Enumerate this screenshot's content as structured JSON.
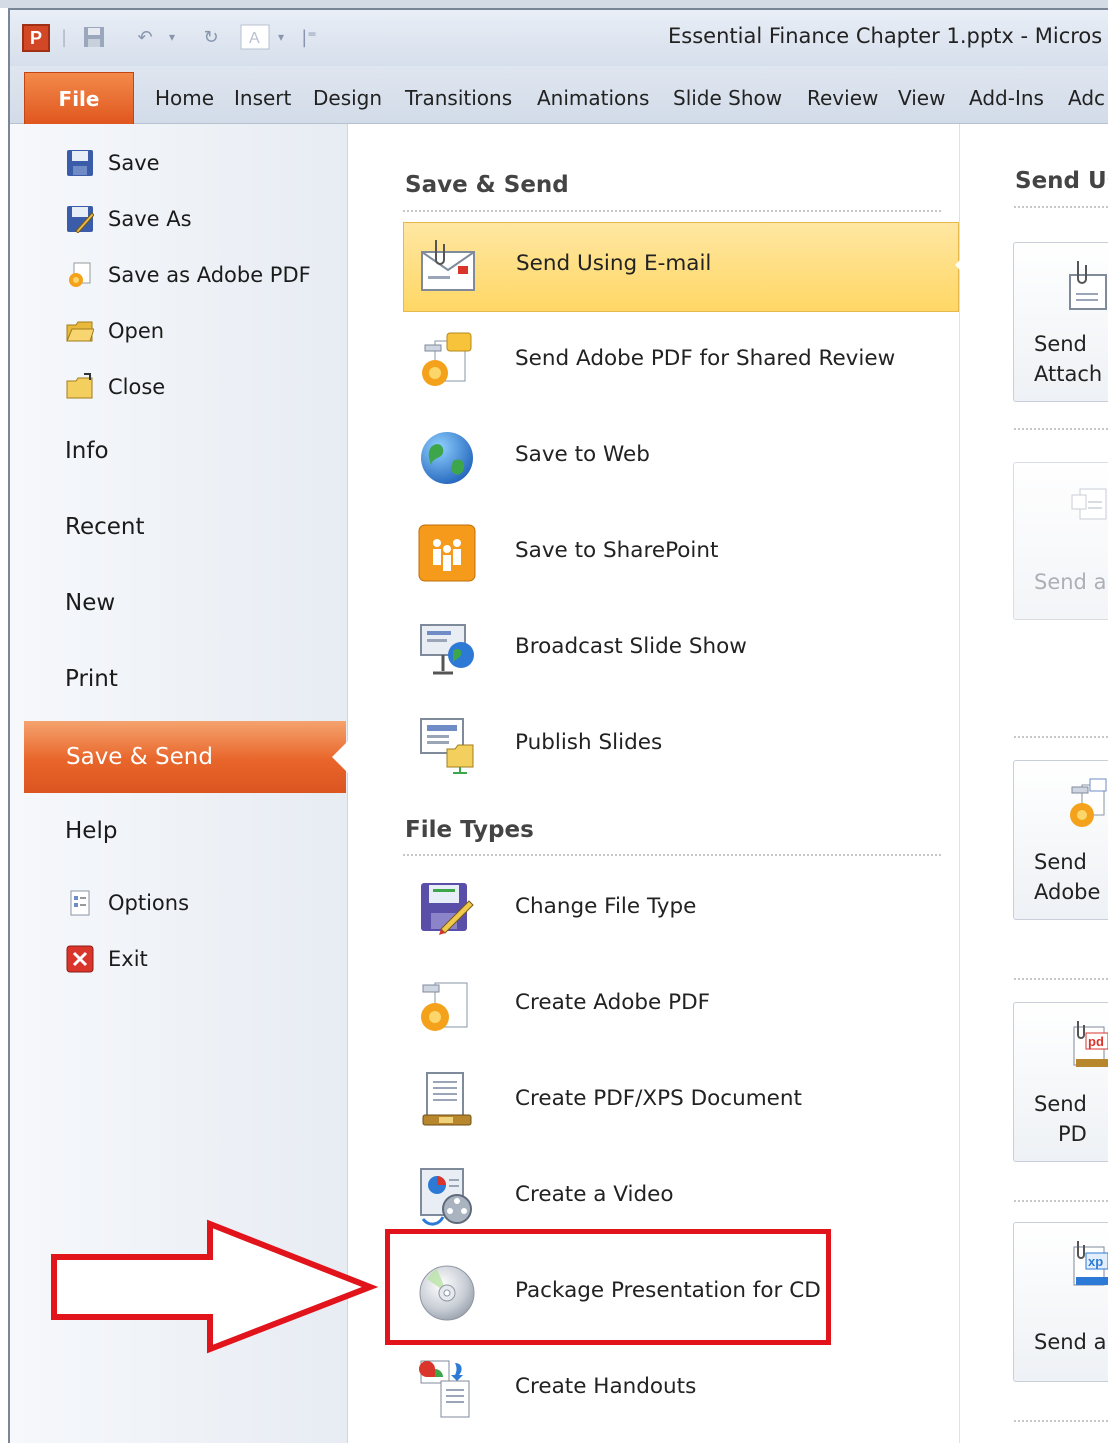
{
  "window": {
    "title": "Essential Finance Chapter 1.pptx  -  Micros",
    "app_letter": "P"
  },
  "ribbon": {
    "file_tab": "File",
    "tabs": [
      "Home",
      "Insert",
      "Design",
      "Transitions",
      "Animations",
      "Slide Show",
      "Review",
      "View",
      "Add-Ins",
      "Adc"
    ]
  },
  "nav": {
    "save": "Save",
    "save_as": "Save As",
    "save_adobe": "Save as Adobe PDF",
    "open": "Open",
    "close": "Close",
    "info": "Info",
    "recent": "Recent",
    "new": "New",
    "print": "Print",
    "save_send": "Save & Send",
    "help": "Help",
    "options": "Options",
    "exit": "Exit"
  },
  "middle": {
    "save_send_head": "Save & Send",
    "file_types_head": "File Types",
    "save_send_items": [
      {
        "label": "Send Using E-mail",
        "icon": "email-icon",
        "selected": true
      },
      {
        "label": "Send Adobe PDF for Shared Review",
        "icon": "adobe-review-icon"
      },
      {
        "label": "Save to Web",
        "icon": "globe-icon"
      },
      {
        "label": "Save to SharePoint",
        "icon": "sharepoint-icon"
      },
      {
        "label": "Broadcast Slide Show",
        "icon": "broadcast-icon"
      },
      {
        "label": "Publish Slides",
        "icon": "publish-slides-icon"
      }
    ],
    "file_type_items": [
      {
        "label": "Change File Type",
        "icon": "change-file-type-icon"
      },
      {
        "label": "Create Adobe PDF",
        "icon": "adobe-pdf-icon"
      },
      {
        "label": "Create PDF/XPS Document",
        "icon": "pdf-xps-icon"
      },
      {
        "label": "Create a Video",
        "icon": "video-icon"
      },
      {
        "label": "Package Presentation for CD",
        "icon": "cd-icon"
      },
      {
        "label": "Create Handouts",
        "icon": "handouts-icon"
      }
    ]
  },
  "right": {
    "head": "Send Us",
    "buttons": [
      {
        "line1": "Send",
        "line2": "Attach"
      },
      {
        "line1": "Send a",
        "line2": ""
      },
      {
        "line1": "Send",
        "line2": "Adobe"
      },
      {
        "line1": "Send",
        "line2": "PD"
      },
      {
        "line1": "Send a",
        "line2": ""
      }
    ],
    "pdf_badge": "pd",
    "xps_badge": "xp"
  },
  "colors": {
    "accent_orange": "#e8652a",
    "selected_yellow": "#ffd765",
    "annotation_red": "#e2141b"
  }
}
